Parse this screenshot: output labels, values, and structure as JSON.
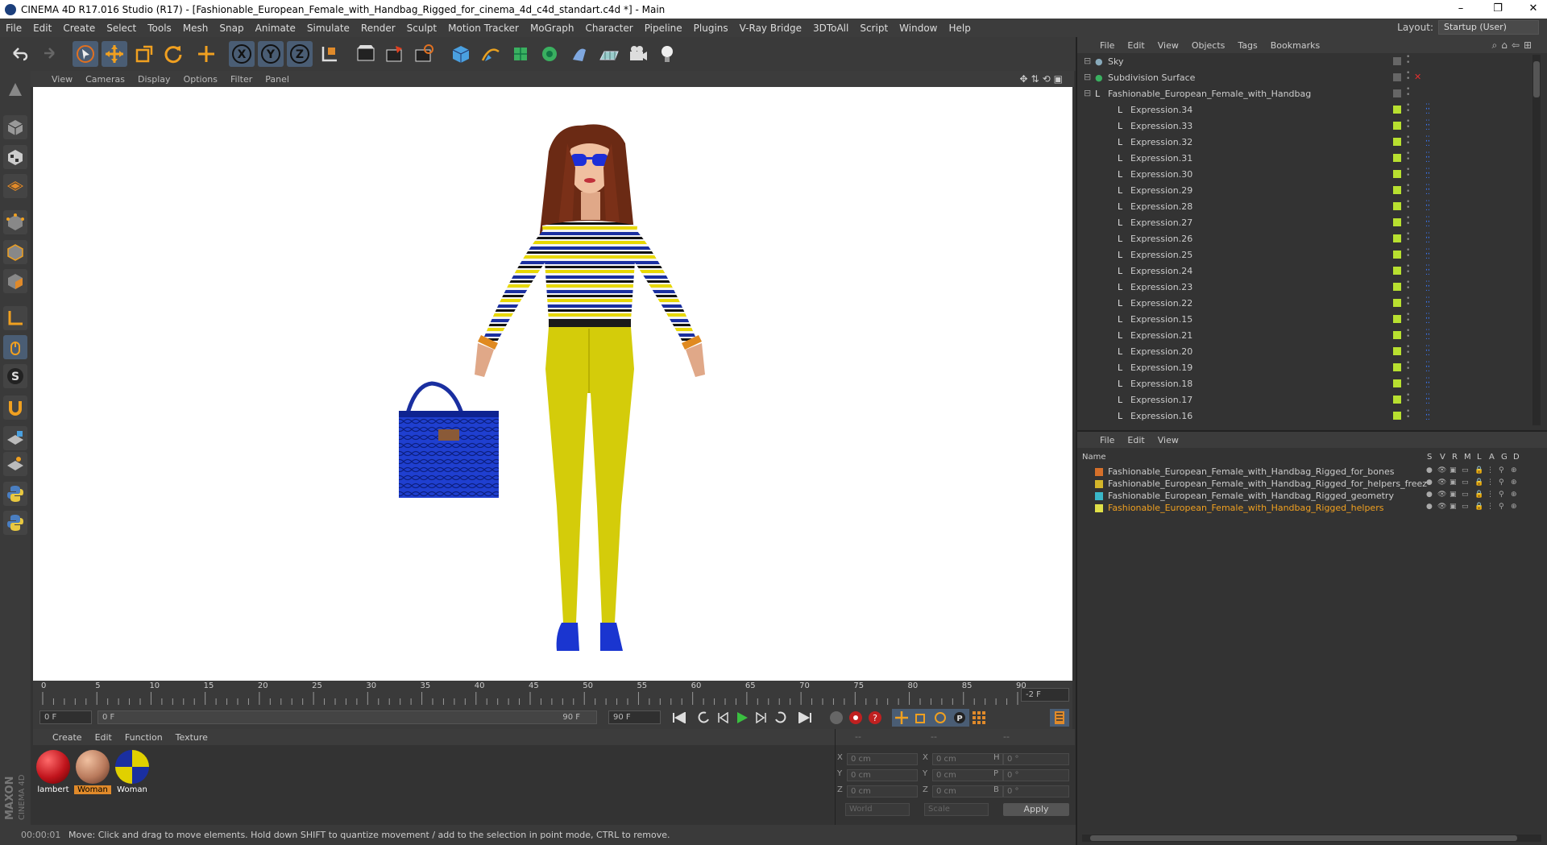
{
  "title": "CINEMA 4D R17.016 Studio (R17) - [Fashionable_European_Female_with_Handbag_Rigged_for_cinema_4d_c4d_standart.c4d *] - Main",
  "menu": [
    "File",
    "Edit",
    "Create",
    "Select",
    "Tools",
    "Mesh",
    "Snap",
    "Animate",
    "Simulate",
    "Render",
    "Sculpt",
    "Motion Tracker",
    "MoGraph",
    "Character",
    "Pipeline",
    "Plugins",
    "V-Ray Bridge",
    "3DToAll",
    "Script",
    "Window",
    "Help"
  ],
  "layout": {
    "label": "Layout:",
    "value": "Startup (User)"
  },
  "viewport_menu": [
    "View",
    "Cameras",
    "Display",
    "Options",
    "Filter",
    "Panel"
  ],
  "timeline": {
    "ticks": [
      "0",
      "5",
      "10",
      "15",
      "20",
      "25",
      "30",
      "35",
      "40",
      "45",
      "50",
      "55",
      "60",
      "65",
      "70",
      "75",
      "80",
      "85",
      "90"
    ],
    "current_frame": "-2 F",
    "start_field": "0 F",
    "range_start": "0 F",
    "range_end": "90 F",
    "end_field": "90 F"
  },
  "materials": {
    "menu": [
      "Create",
      "Edit",
      "Function",
      "Texture"
    ],
    "items": [
      {
        "label": "lambert",
        "color": "#c0141c"
      },
      {
        "label": "Woman",
        "color": "#b97a5c"
      },
      {
        "label": "Woman",
        "color": "#e0d000"
      }
    ]
  },
  "coords": {
    "headers": [
      "--",
      "--",
      "--"
    ],
    "rows": [
      {
        "a": "X",
        "av": "0 cm",
        "b": "X",
        "bv": "0 cm",
        "c": "H",
        "cv": "0 °"
      },
      {
        "a": "Y",
        "av": "0 cm",
        "b": "Y",
        "bv": "0 cm",
        "c": "P",
        "cv": "0 °"
      },
      {
        "a": "Z",
        "av": "0 cm",
        "b": "Z",
        "bv": "0 cm",
        "c": "B",
        "cv": "0 °"
      }
    ],
    "world": "World",
    "scale": "Scale",
    "apply": "Apply"
  },
  "status": {
    "time": "00:00:01",
    "message": "Move: Click and drag to move elements. Hold down SHIFT to quantize movement / add to the selection in point mode, CTRL to remove."
  },
  "object_manager": {
    "menu": [
      "File",
      "Edit",
      "View",
      "Objects",
      "Tags",
      "Bookmarks"
    ],
    "objects": [
      {
        "name": "Sky",
        "indent": 0
      },
      {
        "name": "Subdivision Surface",
        "indent": 0
      },
      {
        "name": "Fashionable_European_Female_with_Handbag",
        "indent": 1
      },
      {
        "name": "Expression.34",
        "indent": 2
      },
      {
        "name": "Expression.33",
        "indent": 2
      },
      {
        "name": "Expression.32",
        "indent": 2
      },
      {
        "name": "Expression.31",
        "indent": 2
      },
      {
        "name": "Expression.30",
        "indent": 2
      },
      {
        "name": "Expression.29",
        "indent": 2
      },
      {
        "name": "Expression.28",
        "indent": 2
      },
      {
        "name": "Expression.27",
        "indent": 2
      },
      {
        "name": "Expression.26",
        "indent": 2
      },
      {
        "name": "Expression.25",
        "indent": 2
      },
      {
        "name": "Expression.24",
        "indent": 2
      },
      {
        "name": "Expression.23",
        "indent": 2
      },
      {
        "name": "Expression.22",
        "indent": 2
      },
      {
        "name": "Expression.15",
        "indent": 2
      },
      {
        "name": "Expression.21",
        "indent": 2
      },
      {
        "name": "Expression.20",
        "indent": 2
      },
      {
        "name": "Expression.19",
        "indent": 2
      },
      {
        "name": "Expression.18",
        "indent": 2
      },
      {
        "name": "Expression.17",
        "indent": 2
      },
      {
        "name": "Expression.16",
        "indent": 2
      }
    ]
  },
  "layer_manager": {
    "menu": [
      "File",
      "Edit",
      "View"
    ],
    "name_header": "Name",
    "columns": [
      "S",
      "V",
      "R",
      "M",
      "L",
      "A",
      "G",
      "D"
    ],
    "layers": [
      {
        "name": "Fashionable_European_Female_with_Handbag_Rigged_for_bones",
        "color": "#d6702a",
        "highlight": false
      },
      {
        "name": "Fashionable_European_Female_with_Handbag_Rigged_for_helpers_freez",
        "color": "#d4b62a",
        "highlight": false
      },
      {
        "name": "Fashionable_European_Female_with_Handbag_Rigged_geometry",
        "color": "#3ab7c8",
        "highlight": false
      },
      {
        "name": "Fashionable_European_Female_with_Handbag_Rigged_helpers",
        "color": "#e0e048",
        "highlight": true
      }
    ]
  },
  "brand": "MAXON CINEMA 4D"
}
